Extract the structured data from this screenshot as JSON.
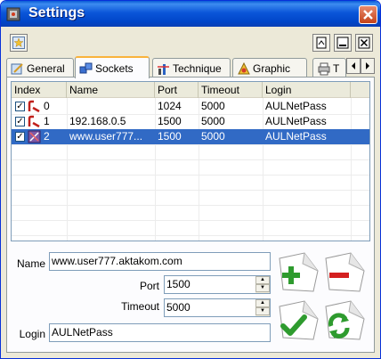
{
  "window": {
    "title": "Settings"
  },
  "tabs": [
    {
      "label": "General",
      "icon": "general-icon"
    },
    {
      "label": "Sockets",
      "icon": "sockets-icon"
    },
    {
      "label": "Technique",
      "icon": "technique-icon"
    },
    {
      "label": "Graphic",
      "icon": "graphic-icon"
    },
    {
      "label": "Т",
      "icon": "printer-icon"
    }
  ],
  "active_tab": "Sockets",
  "table": {
    "columns": [
      "Index",
      "Name",
      "Port",
      "Timeout",
      "Login"
    ],
    "rows": [
      {
        "index": "0",
        "name": "",
        "port": "1024",
        "timeout": "5000",
        "login": "AULNetPass",
        "checked": true,
        "selected": false
      },
      {
        "index": "1",
        "name": "192.168.0.5",
        "port": "1500",
        "timeout": "5000",
        "login": "AULNetPass",
        "checked": true,
        "selected": false
      },
      {
        "index": "2",
        "name": "www.user777...",
        "port": "1500",
        "timeout": "5000",
        "login": "AULNetPass",
        "checked": true,
        "selected": true
      }
    ]
  },
  "form": {
    "name_label": "Name",
    "name_value": "www.user777.aktakom.com",
    "port_label": "Port",
    "port_value": "1500",
    "timeout_label": "Timeout",
    "timeout_value": "5000",
    "login_label": "Login",
    "login_value": "AULNetPass"
  },
  "colors": {
    "selection": "#316ac5",
    "titlebar": "#0b56d9",
    "add": "#2e9b2e",
    "remove": "#d42020"
  }
}
